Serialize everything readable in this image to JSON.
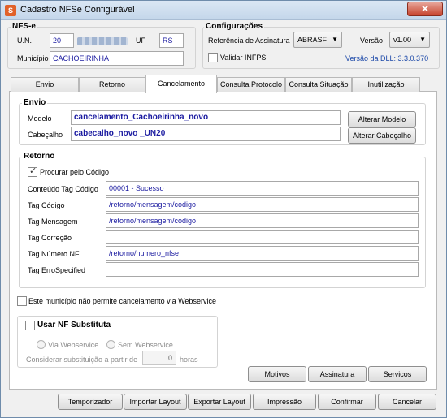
{
  "window": {
    "title": "Cadastro NFSe Configurável",
    "close_glyph": "✕"
  },
  "nfse": {
    "group_title": "NFS-e",
    "un_label": "U.N.",
    "un_value": "20",
    "uf_label": "UF",
    "uf_value": "RS",
    "municipio_label": "Município",
    "municipio_value": "CACHOEIRINHA"
  },
  "config": {
    "group_title": "Configurações",
    "ref_label": "Referência de Assinatura",
    "ref_value": "ABRASF",
    "versao_label": "Versão",
    "versao_value": "v1.00",
    "validar_label": "Validar INFPS",
    "validar_checked": false,
    "dll_version": "Versão da DLL: 3.3.0.370"
  },
  "tabs": [
    "Envio",
    "Retorno",
    "Cancelamento",
    "Consulta Protocolo",
    "Consulta Situação",
    "Inutilização"
  ],
  "active_tab": "Cancelamento",
  "envio": {
    "group_title": "Envio",
    "modelo_label": "Modelo",
    "modelo_value": "cancelamento_Cachoeirinha_novo",
    "alterar_modelo": "Alterar Modelo",
    "cabecalho_label": "Cabeçalho",
    "cabecalho_value": "cabecalho_novo _UN20",
    "alterar_cabecalho": "Alterar Cabeçalho"
  },
  "retorno": {
    "group_title": "Retorno",
    "procurar_label": "Procurar pelo Código",
    "procurar_checked": true,
    "rows": [
      {
        "label": "Conteúdo Tag Código",
        "value": "00001 - Sucesso"
      },
      {
        "label": "Tag Código",
        "value": "/retorno/mensagem/codigo"
      },
      {
        "label": "Tag Mensagem",
        "value": "/retorno/mensagem/codigo"
      },
      {
        "label": "Tag Correção",
        "value": ""
      },
      {
        "label": "Tag Número NF",
        "value": "/retorno/numero_nfse"
      },
      {
        "label": "Tag ErroSpecified",
        "value": ""
      }
    ]
  },
  "nao_permite_label": "Este município não permite cancelamento via Webservice",
  "substituta": {
    "title": "Usar NF Substituta",
    "via_ws": "Via Webservice",
    "sem_ws": "Sem Webservice",
    "considerar_label": "Considerar substituição a partir de",
    "horas_value": "0",
    "horas_label": "horas"
  },
  "panel_buttons": {
    "motivos": "Motivos",
    "assinatura": "Assinatura",
    "servicos": "Servicos"
  },
  "bottom_buttons": {
    "temporizador": "Temporizador",
    "importar": "Importar Layout",
    "exportar": "Exportar Layout",
    "impressao": "Impressão",
    "confirmar": "Confirmar",
    "cancelar": "Cancelar"
  }
}
